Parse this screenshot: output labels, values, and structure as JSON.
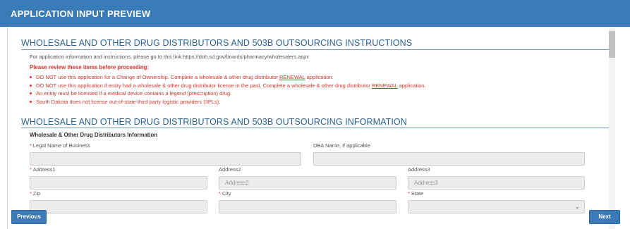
{
  "header": {
    "title": "APPLICATION INPUT PREVIEW"
  },
  "instructions": {
    "title": "WHOLESALE AND OTHER DRUG DISTRIBUTORS AND 503B OUTSOURCING INSTRUCTIONS",
    "info_text": "For application information and instructions, please go to this link:https://doh.sd.gov/boards/pharmacy/wholesalers.aspx",
    "review_heading": "Please review these items before proceeding:",
    "bullet1_a": "DO NOT use this application for a Change of Ownership. Complete a wholesale & other drug distributor ",
    "bullet1_link": "RENEWAL",
    "bullet1_b": " application.",
    "bullet2_a": "DO NOT use this application if entity had a wholesale & other drug distributor license in the past. Complete a wholesale & other drug distributor ",
    "bullet2_link": "RENEWAL",
    "bullet2_b": " application.",
    "bullet3": "An entity must be licensed if a medical device contains a legend (prescription) drug.",
    "bullet4": "South Dakota does not license out-of-state third party logistic providers (3PLs)."
  },
  "information": {
    "title": "WHOLESALE AND OTHER DRUG DISTRIBUTORS AND 503B OUTSOURCING INFORMATION",
    "subheading": "Wholesale & Other Drug Distributors Information",
    "fields": {
      "legal_name_label": "Legal Name of Business",
      "dba_label": "DBA Name, if applicable",
      "address1_label": "Address1",
      "address2_label": "Address2",
      "address2_placeholder": "Address2",
      "address3_label": "Address3",
      "address3_placeholder": "Address3",
      "zip_label": "Zip",
      "city_label": "City",
      "state_label": "State"
    }
  },
  "buttons": {
    "previous": "Previous",
    "next": "Next"
  },
  "icons": {
    "required_marker": "*",
    "chevron": "chevron-down-icon"
  },
  "colors": {
    "accent": "#3a7ab6",
    "warning": "#d9342b",
    "section_title": "#2c5f8f"
  }
}
